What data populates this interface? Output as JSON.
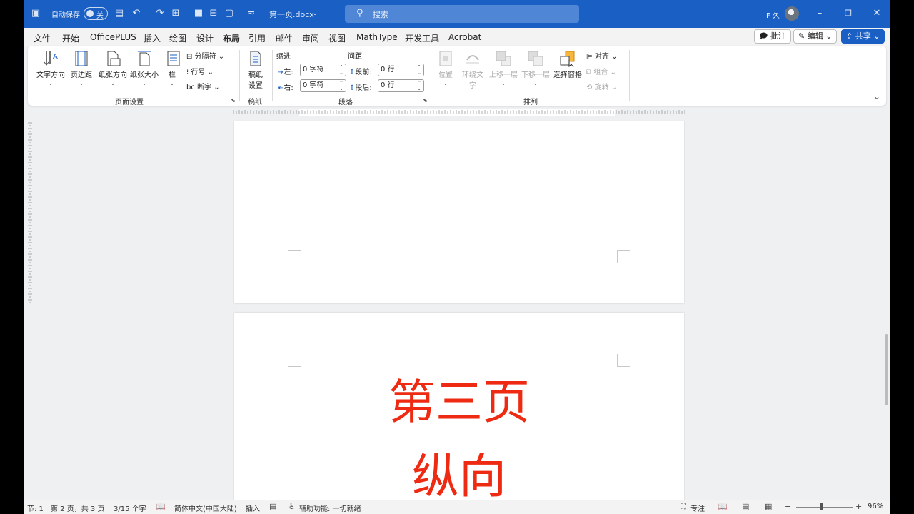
{
  "titlebar": {
    "autosave_label": "自动保存",
    "autosave_state": "关",
    "doc_title": "第一页.docx",
    "search_placeholder": "搜索",
    "user": "F 久"
  },
  "menu": {
    "tabs": [
      "文件",
      "开始",
      "OfficePLUS",
      "插入",
      "绘图",
      "设计",
      "布局",
      "引用",
      "邮件",
      "审阅",
      "视图",
      "MathType",
      "开发工具",
      "Acrobat"
    ],
    "active": "布局",
    "comment_btn": "批注",
    "edit_btn": "编辑",
    "share_btn": "共享"
  },
  "ribbon": {
    "page_setup": {
      "text_direction": "文字方向",
      "margins": "页边距",
      "orientation": "纸张方向",
      "size": "纸张大小",
      "columns": "栏",
      "breaks": "分隔符",
      "line_numbers": "行号",
      "hyphenation": "断字",
      "group": "页面设置"
    },
    "manuscript": {
      "btn_line1": "稿纸",
      "btn_line2": "设置",
      "group": "稿纸"
    },
    "paragraph": {
      "indent_title": "缩进",
      "spacing_title": "间距",
      "left_label": "左:",
      "left_value": "0 字符",
      "right_label": "右:",
      "right_value": "0 字符",
      "before_label": "段前:",
      "before_value": "0 行",
      "after_label": "段后:",
      "after_value": "0 行",
      "group": "段落"
    },
    "arrange": {
      "position": "位置",
      "wrap_line1": "环绕文",
      "wrap_line2": "字",
      "forward": "上移一层",
      "backward": "下移一层",
      "selection_pane": "选择窗格",
      "align": "对齐",
      "group_btn": "组合",
      "rotate": "旋转",
      "group": "排列"
    }
  },
  "document": {
    "page3_line1": "第三页",
    "page3_line2": "纵向"
  },
  "status": {
    "section": "节: 1",
    "page": "第 2 页，共 3 页",
    "words": "3/15 个字",
    "language": "简体中文(中国大陆)",
    "mode": "插入",
    "accessibility": "辅助功能: 一切就绪",
    "focus": "专注",
    "zoom": "96%"
  },
  "colors": {
    "titlebar": "#1a5fc4",
    "accent_text": "#ee2a12"
  }
}
